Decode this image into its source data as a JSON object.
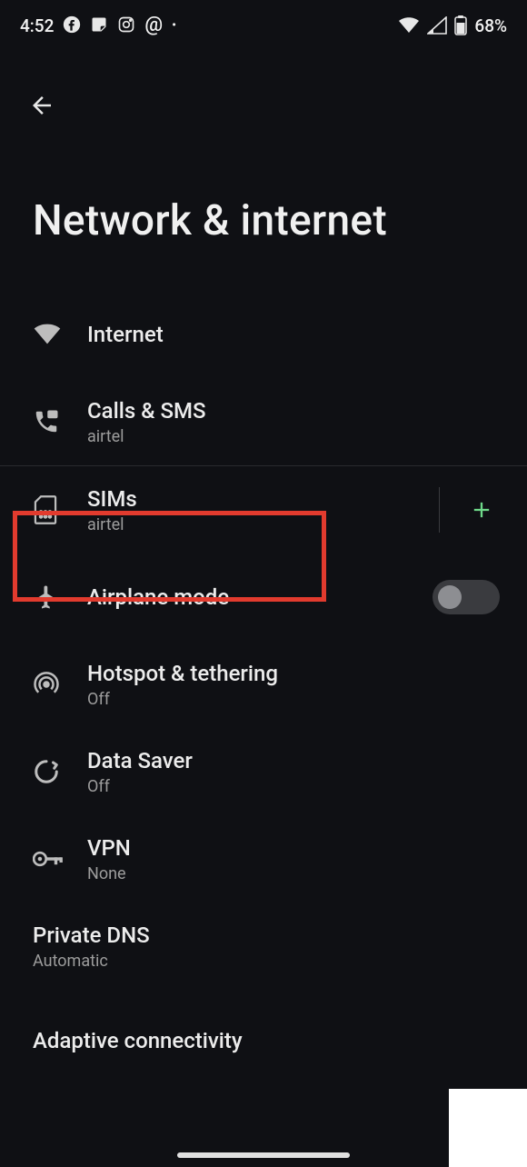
{
  "status": {
    "time": "4:52",
    "battery_pct": "68%"
  },
  "header": {
    "title": "Network & internet"
  },
  "items": {
    "internet": {
      "title": "Internet"
    },
    "calls": {
      "title": "Calls & SMS",
      "sub": "airtel"
    },
    "sims": {
      "title": "SIMs",
      "sub": "airtel"
    },
    "airplane": {
      "title": "Airplane mode"
    },
    "hotspot": {
      "title": "Hotspot & tethering",
      "sub": "Off"
    },
    "saver": {
      "title": "Data Saver",
      "sub": "Off"
    },
    "vpn": {
      "title": "VPN",
      "sub": "None"
    },
    "dns": {
      "title": "Private DNS",
      "sub": "Automatic"
    },
    "adaptive": {
      "title": "Adaptive connectivity"
    }
  },
  "toggles": {
    "airplane": false
  }
}
